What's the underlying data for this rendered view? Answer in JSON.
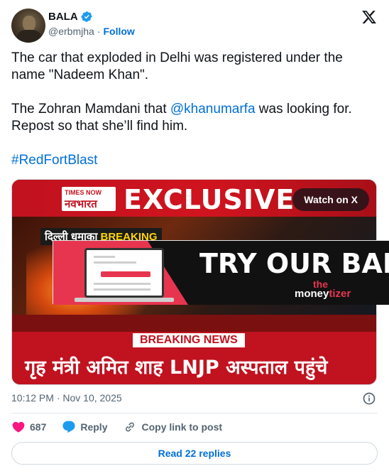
{
  "header": {
    "display_name": "BALA",
    "handle": "@erbmjha",
    "separator": "·",
    "follow_label": "Follow"
  },
  "tweet": {
    "line1": "The car that exploded in Delhi was registered under the name \"Nadeem Khan\".",
    "line2_before": "The Zohran Mamdani that ",
    "line2_mention": "@khanumarfa",
    "line2_after": " was looking for. Repost so that she’ll find him.",
    "hashtag": "#RedFortBlast"
  },
  "media": {
    "channel_top": "TIMES NOW",
    "channel_bottom": "नवभारत",
    "banner": "EXCLUSIVE",
    "breaking_tag_a": "दिल्ली धमाका",
    "breaking_tag_b": "BREAKING",
    "watch_label": "Watch on X",
    "breaking_news": "BREAKING NEWS",
    "headline": "गृह मंत्री अमित शाह LNJP अस्पताल पहुंचे"
  },
  "ad": {
    "title": "TRY OUR BAN",
    "brand_line1": "the",
    "brand_line2": "money",
    "brand_line3": "tizer",
    "accent": "#e8354f"
  },
  "meta": {
    "timestamp": "10:12 PM · Nov 10, 2025"
  },
  "actions": {
    "like_count": "687",
    "reply_label": "Reply",
    "copy_label": "Copy link to post"
  },
  "footer": {
    "read_replies": "Read 22 replies"
  },
  "colors": {
    "link": "#006fd6",
    "like": "#f91880",
    "muted": "#536471"
  }
}
